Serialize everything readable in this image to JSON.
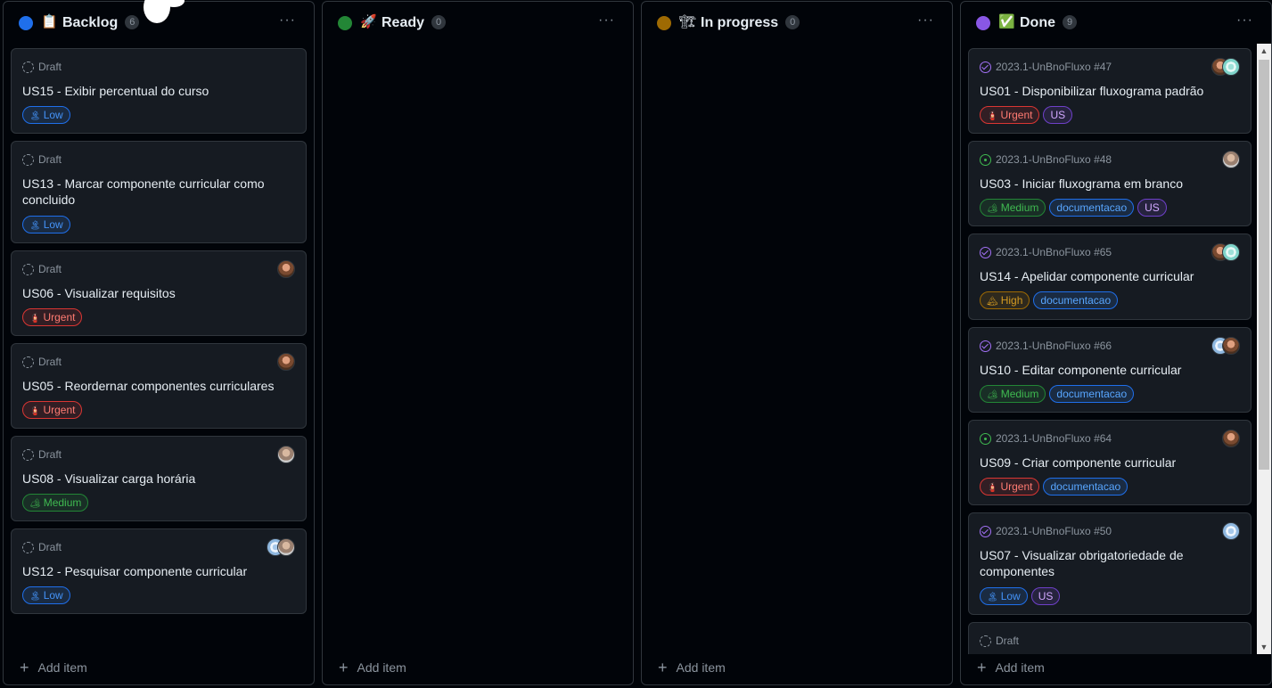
{
  "colors": {
    "backlog_dot": "#1f6feb",
    "ready_dot": "#238636",
    "inprogress_dot": "#9e6a03",
    "done_dot": "#8957e5"
  },
  "columns": [
    {
      "name": "Backlog",
      "emoji": "📋",
      "count": "6",
      "menu": "···",
      "add_item": "Add item",
      "cards": [
        {
          "status": "Draft",
          "status_icon": "draft-icon",
          "title": "US15 - Exibir percentual do curso",
          "labels": [
            {
              "emoji": "🏝",
              "text": "Low"
            }
          ],
          "avatars": []
        },
        {
          "status": "Draft",
          "status_icon": "draft-icon",
          "title": "US13 - Marcar componente curricular como concluido",
          "labels": [
            {
              "emoji": "🏝",
              "text": "Low"
            }
          ],
          "avatars": []
        },
        {
          "status": "Draft",
          "status_icon": "draft-icon",
          "title": "US06 - Visualizar requisitos",
          "labels": [
            {
              "emoji": "🧯",
              "text": "Urgent"
            }
          ],
          "avatars": [
            "brown"
          ]
        },
        {
          "status": "Draft",
          "status_icon": "draft-icon",
          "title": "US05 - Reordernar componentes curriculares",
          "labels": [
            {
              "emoji": "🧯",
              "text": "Urgent"
            }
          ],
          "avatars": [
            "brown"
          ]
        },
        {
          "status": "Draft",
          "status_icon": "draft-icon",
          "title": "US08 - Visualizar carga horária",
          "labels": [
            {
              "emoji": "🏕",
              "text": "Medium"
            }
          ],
          "avatars": [
            "light"
          ]
        },
        {
          "status": "Draft",
          "status_icon": "draft-icon",
          "title": "US12 - Pesquisar componente curricular",
          "labels": [
            {
              "emoji": "🏝",
              "text": "Low"
            }
          ],
          "avatars": [
            "blue",
            "light"
          ]
        }
      ]
    },
    {
      "name": "Ready",
      "emoji": "🚀",
      "count": "0",
      "menu": "···",
      "add_item": "Add item",
      "cards": []
    },
    {
      "name": "In progress",
      "emoji": "🏗",
      "count": "0",
      "menu": "···",
      "add_item": "Add item",
      "cards": []
    },
    {
      "name": "Done",
      "emoji": "✅",
      "count": "9",
      "menu": "···",
      "add_item": "Add item",
      "cards": [
        {
          "status": "2023.1-UnBnoFluxo #47",
          "status_icon": "done-icon",
          "title": "US01 - Disponibilizar fluxograma padrão",
          "labels": [
            {
              "emoji": "🧯",
              "text": "Urgent"
            },
            {
              "emoji": "",
              "text": "US"
            }
          ],
          "avatars": [
            "brown",
            "teal"
          ]
        },
        {
          "status": "2023.1-UnBnoFluxo #48",
          "status_icon": "open-icon",
          "title": "US03 - Iniciar fluxograma em branco",
          "labels": [
            {
              "emoji": "🏕",
              "text": "Medium"
            },
            {
              "emoji": "",
              "text": "documentacao"
            },
            {
              "emoji": "",
              "text": "US"
            }
          ],
          "avatars": [
            "light"
          ]
        },
        {
          "status": "2023.1-UnBnoFluxo #65",
          "status_icon": "done-icon",
          "title": "US14 - Apelidar componente curricular",
          "labels": [
            {
              "emoji": "🏔",
              "text": "High"
            },
            {
              "emoji": "",
              "text": "documentacao"
            }
          ],
          "avatars": [
            "brown",
            "teal"
          ]
        },
        {
          "status": "2023.1-UnBnoFluxo #66",
          "status_icon": "done-icon",
          "title": "US10 - Editar componente curricular",
          "labels": [
            {
              "emoji": "🏕",
              "text": "Medium"
            },
            {
              "emoji": "",
              "text": "documentacao"
            }
          ],
          "avatars": [
            "blue",
            "brown"
          ]
        },
        {
          "status": "2023.1-UnBnoFluxo #64",
          "status_icon": "open-icon",
          "title": "US09 - Criar componente curricular",
          "labels": [
            {
              "emoji": "🧯",
              "text": "Urgent"
            },
            {
              "emoji": "",
              "text": "documentacao"
            }
          ],
          "avatars": [
            "brown"
          ]
        },
        {
          "status": "2023.1-UnBnoFluxo #50",
          "status_icon": "done-icon",
          "title": "US07 - Visualizar obrigatoriedade de componentes",
          "labels": [
            {
              "emoji": "🏝",
              "text": "Low"
            },
            {
              "emoji": "",
              "text": "US"
            }
          ],
          "avatars": [
            "blue"
          ]
        },
        {
          "status": "Draft",
          "status_icon": "draft-icon",
          "title": "",
          "labels": [],
          "avatars": []
        }
      ]
    }
  ],
  "scrollbar": {
    "up_arrow": "▲",
    "down_arrow": "▼"
  }
}
